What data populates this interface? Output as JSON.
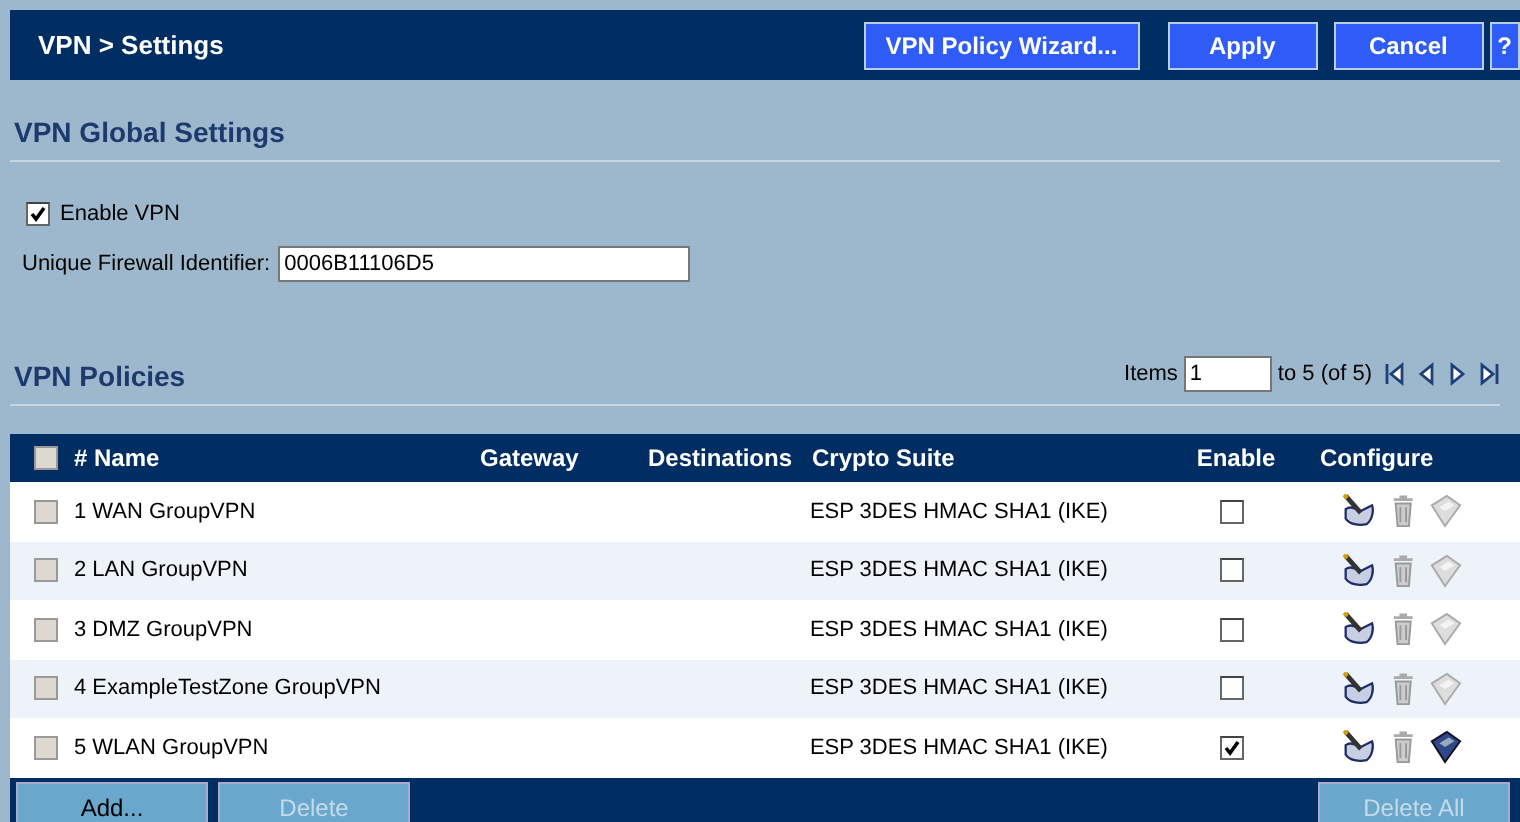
{
  "header": {
    "title": "VPN > Settings",
    "buttons": [
      {
        "label": "VPN Policy Wizard...",
        "kind": "wide"
      },
      {
        "label": "Apply",
        "kind": "normal"
      },
      {
        "label": "Cancel",
        "kind": "normal"
      },
      {
        "label": "?",
        "kind": "help"
      }
    ]
  },
  "global": {
    "title": "VPN Global Settings",
    "enable_label": "Enable VPN",
    "enable_checked": true,
    "identifier_label": "Unique Firewall Identifier:",
    "identifier_value": "0006B11106D5"
  },
  "policies": {
    "title": "VPN Policies",
    "pager": {
      "items_label": "Items",
      "value": "1",
      "range": "to 5 (of 5)"
    },
    "columns": [
      "# Name",
      "Gateway",
      "Destinations",
      "Crypto Suite",
      "Enable",
      "Configure"
    ],
    "select_all_checked": false,
    "rows": [
      {
        "name": "1 WAN GroupVPN",
        "crypto": "ESP 3DES HMAC SHA1 (IKE)",
        "selected": false,
        "enabled": false
      },
      {
        "name": "2 LAN GroupVPN",
        "crypto": "ESP 3DES HMAC SHA1 (IKE)",
        "selected": false,
        "enabled": false
      },
      {
        "name": "3 DMZ GroupVPN",
        "crypto": "ESP 3DES HMAC SHA1 (IKE)",
        "selected": false,
        "enabled": false
      },
      {
        "name": "4 ExampleTestZone GroupVPN",
        "crypto": "ESP 3DES HMAC SHA1 (IKE)",
        "selected": false,
        "enabled": false
      },
      {
        "name": "5 WLAN GroupVPN",
        "crypto": "ESP 3DES HMAC SHA1 (IKE)",
        "selected": false,
        "enabled": true
      }
    ],
    "footer_buttons": [
      {
        "label": "Add...",
        "disabled": false
      },
      {
        "label": "Delete",
        "disabled": true
      }
    ],
    "delete_all": {
      "label": "Delete All",
      "disabled": true
    }
  }
}
